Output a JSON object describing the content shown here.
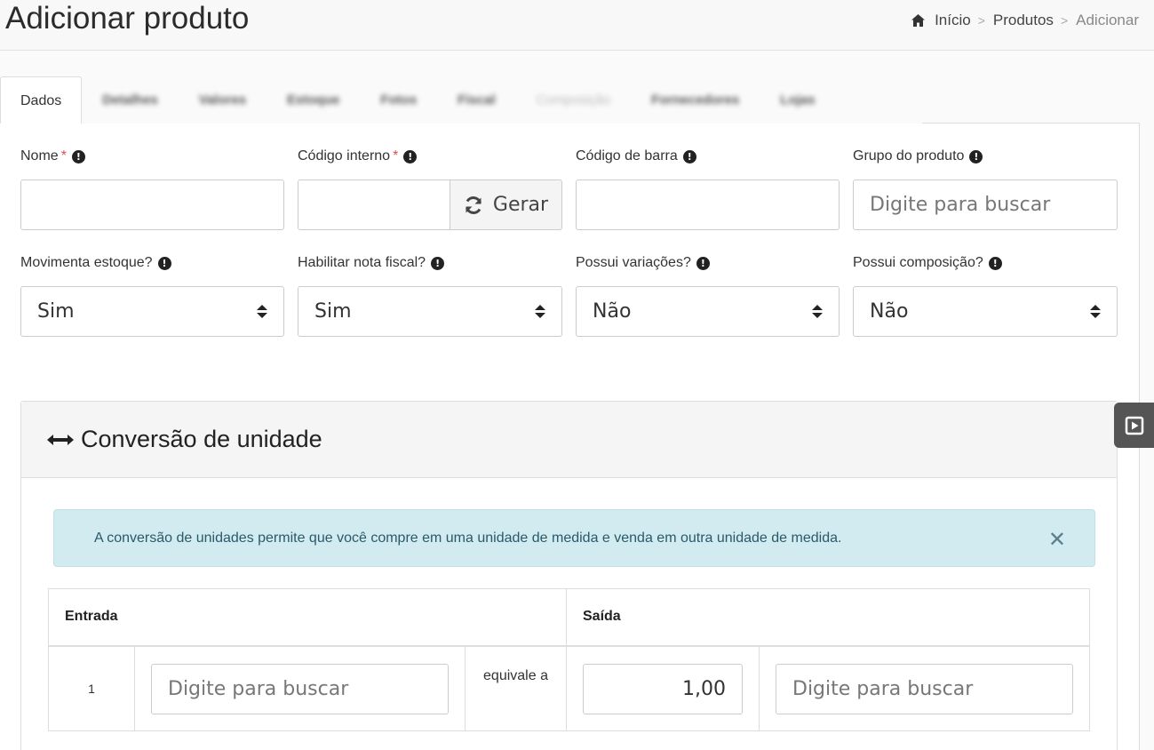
{
  "header": {
    "title": "Adicionar produto",
    "breadcrumb": {
      "home": "Início",
      "products": "Produtos",
      "current": "Adicionar"
    }
  },
  "tabs": [
    {
      "label": "Dados",
      "state": "active"
    },
    {
      "label": "Detalhes",
      "state": "blurred"
    },
    {
      "label": "Valores",
      "state": "blurred"
    },
    {
      "label": "Estoque",
      "state": "blurred"
    },
    {
      "label": "Fotos",
      "state": "blurred"
    },
    {
      "label": "Fiscal",
      "state": "blurred"
    },
    {
      "label": "Composição",
      "state": "blurred-disabled"
    },
    {
      "label": "Fornecedores",
      "state": "blurred"
    },
    {
      "label": "Lojas",
      "state": "blurred"
    }
  ],
  "form": {
    "nome": {
      "label": "Nome",
      "value": ""
    },
    "codigo_interno": {
      "label": "Código interno",
      "value": "",
      "button": "Gerar"
    },
    "codigo_barra": {
      "label": "Código de barra",
      "value": ""
    },
    "grupo": {
      "label": "Grupo do produto",
      "placeholder": "Digite para buscar"
    },
    "movimenta_estoque": {
      "label": "Movimenta estoque?",
      "value": "Sim"
    },
    "nota_fiscal": {
      "label": "Habilitar nota fiscal?",
      "value": "Sim"
    },
    "variacoes": {
      "label": "Possui variações?",
      "value": "Não"
    },
    "composicao": {
      "label": "Possui composição?",
      "value": "Não"
    }
  },
  "conversion": {
    "title": "Conversão de unidade",
    "alert": "A conversão de unidades permite que você compre em uma unidade de medida e venda em outra unidade de medida.",
    "headers": {
      "entrada": "Entrada",
      "saida": "Saída"
    },
    "row": {
      "qty_in": "1",
      "unit_in_placeholder": "Digite para buscar",
      "equivale": "equivale a",
      "qty_out": "1,00",
      "unit_out_placeholder": "Digite para buscar"
    }
  },
  "colors": {
    "required": "#d9534f",
    "alert_bg": "#d1ebf0",
    "side_tab": "#555555"
  }
}
